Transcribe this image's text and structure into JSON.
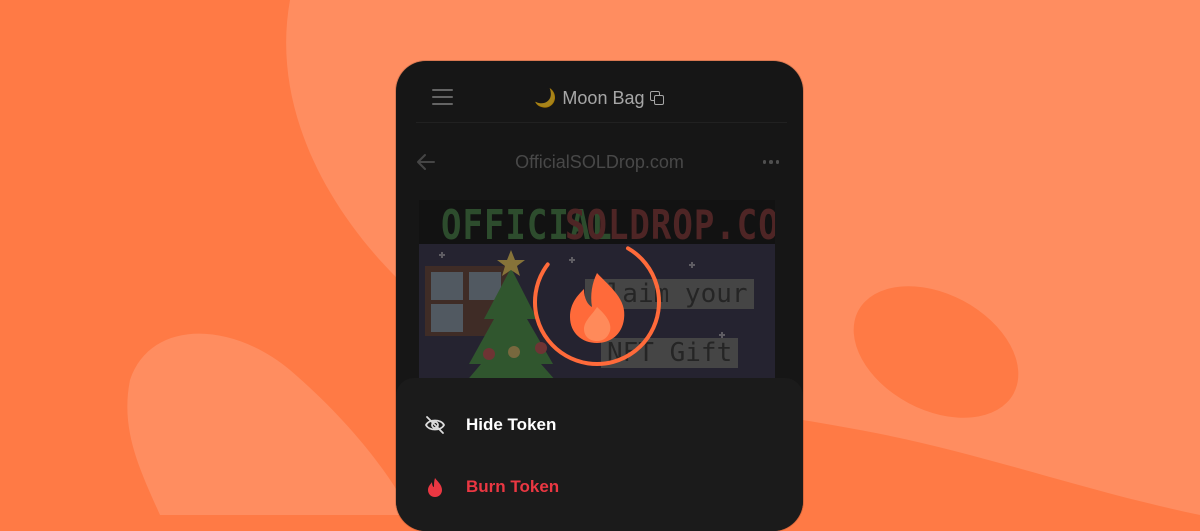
{
  "colors": {
    "background": "#ff7a45",
    "background_blob": "#ff8d60",
    "phone_bg": "#232323",
    "sheet_bg": "#1b1b1b",
    "burn_accent": "#eb3742",
    "spinner_accent": "#ff6a3a"
  },
  "header": {
    "menu_icon": "hamburger-icon",
    "account_emoji": "🌙",
    "account_name": "Moon Bag",
    "copy_icon": "copy-icon"
  },
  "subheader": {
    "back_icon": "back-arrow-icon",
    "title": "OfficialSOLDrop.com",
    "more_icon": "more-icon"
  },
  "nft": {
    "banner_part1": "OFFICIAL",
    "banner_part2": "SOLDROP.COM",
    "line1": "Claim your",
    "line2": "NFT Gift"
  },
  "burn_overlay": {
    "icon": "fire-icon"
  },
  "menu": {
    "items": [
      {
        "label": "Hide Token",
        "icon": "eye-off-icon"
      },
      {
        "label": "Burn Token",
        "icon": "flame-icon"
      }
    ]
  }
}
